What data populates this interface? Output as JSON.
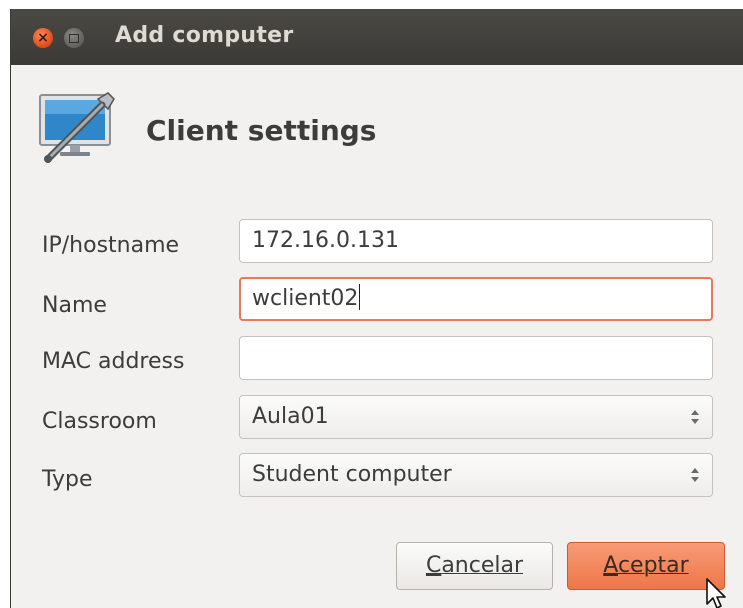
{
  "window": {
    "title": "Add computer",
    "close_icon": "×"
  },
  "header": {
    "title": "Client settings",
    "icon": "monitor-wrench-icon"
  },
  "form": {
    "ip_label": "IP/hostname",
    "ip_value": "172.16.0.131",
    "name_label": "Name",
    "name_value": "wclient02",
    "mac_label": "MAC address",
    "mac_value": "",
    "classroom_label": "Classroom",
    "classroom_value": "Aula01",
    "type_label": "Type",
    "type_value": "Student computer"
  },
  "buttons": {
    "cancel_mnemonic": "C",
    "cancel_rest": "ancelar",
    "ok_mnemonic": "A",
    "ok_rest": "ceptar"
  },
  "colors": {
    "titlebar": "#3b3a36",
    "accent": "#ee7647",
    "focus_border": "#e8795a",
    "dialog_bg": "#f2f1f0"
  }
}
